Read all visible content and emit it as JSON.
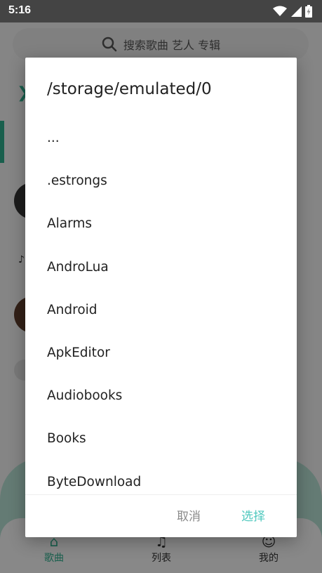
{
  "status_bar": {
    "time": "5:16"
  },
  "background": {
    "search_placeholder": "搜索歌曲 艺人 专辑",
    "nav": {
      "songs": "歌曲",
      "list": "列表",
      "mine": "我的"
    }
  },
  "dialog": {
    "title": "/storage/emulated/0",
    "items": [
      {
        "label": "..."
      },
      {
        "label": ".estrongs"
      },
      {
        "label": "Alarms"
      },
      {
        "label": "AndroLua"
      },
      {
        "label": "Android"
      },
      {
        "label": "ApkEditor"
      },
      {
        "label": "Audiobooks"
      },
      {
        "label": "Books"
      },
      {
        "label": "ByteDownload"
      }
    ],
    "cancel_label": "取消",
    "select_label": "选择"
  },
  "colors": {
    "accent": "#4fc8be",
    "brand_green": "#2fae8d",
    "cancel_text": "#8a8a8a"
  }
}
